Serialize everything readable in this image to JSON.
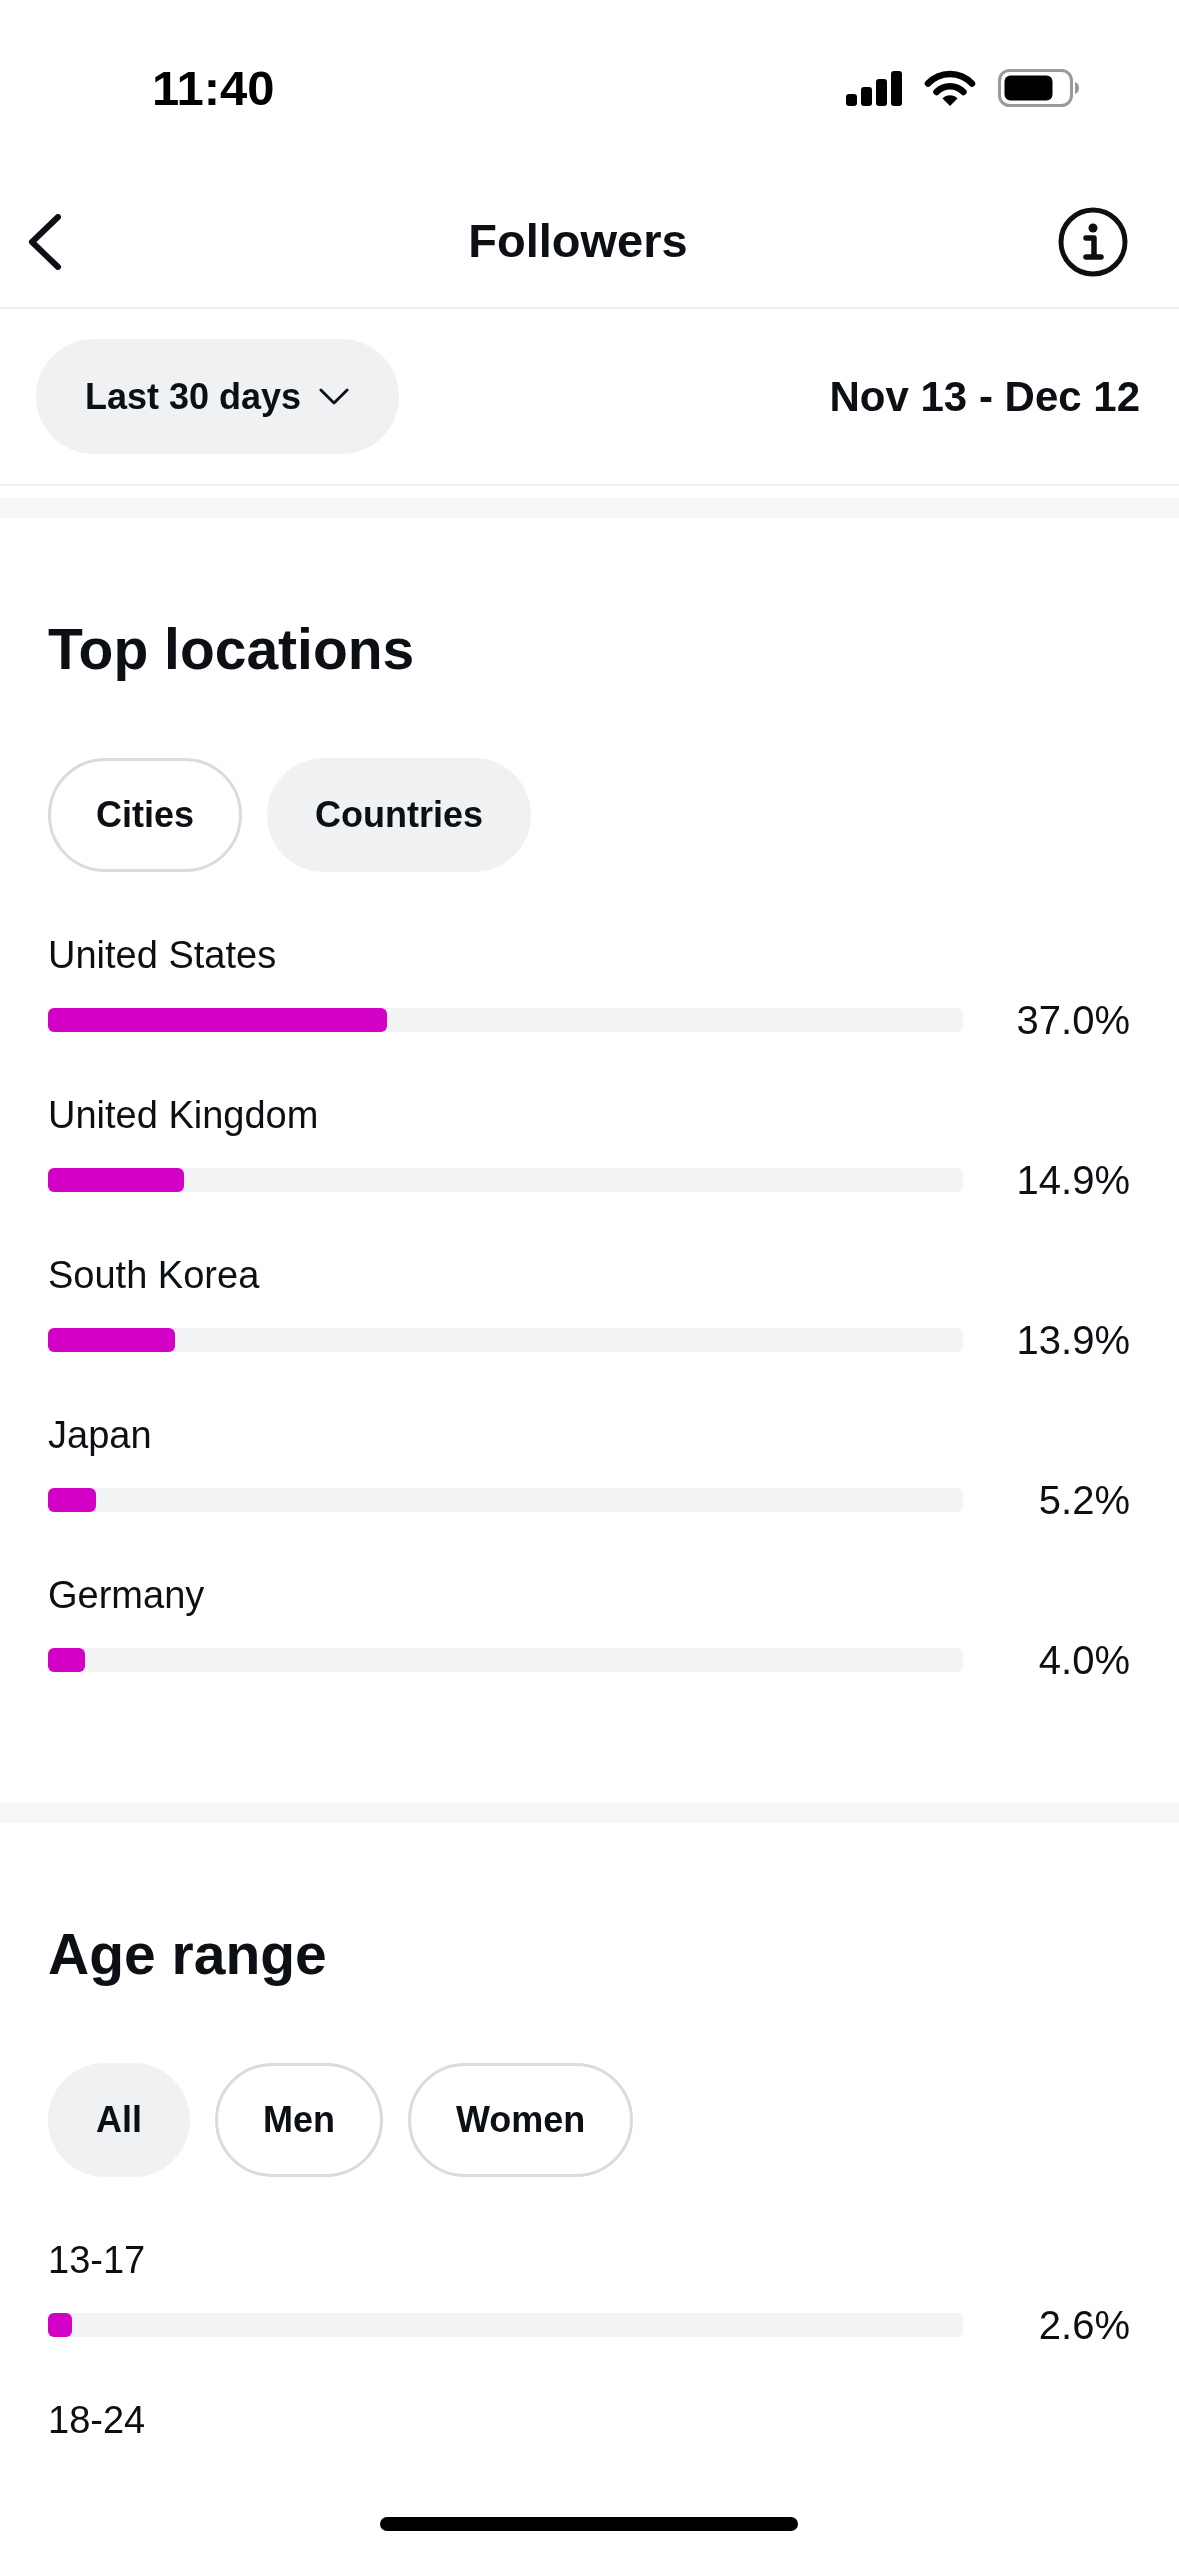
{
  "status_bar": {
    "time": "11:40"
  },
  "nav_bar": {
    "title": "Followers"
  },
  "filter": {
    "period": "Last 30 days",
    "date_range": "Nov 13 - Dec 12"
  },
  "sections": [
    {
      "title": "Top locations",
      "tabs": [
        {
          "label": "Cities",
          "selected": false
        },
        {
          "label": "Countries",
          "selected": true
        }
      ],
      "rows": [
        {
          "label": "United States",
          "level": 0.37,
          "value": "37.0%"
        },
        {
          "label": "United Kingdom",
          "level": 0.149,
          "value": "14.9%"
        },
        {
          "label": "South Korea",
          "level": 0.139,
          "value": "13.9%"
        },
        {
          "label": "Japan",
          "level": 0.052,
          "value": "5.2%"
        },
        {
          "label": "Germany",
          "level": 0.04,
          "value": "4.0%"
        }
      ]
    },
    {
      "title": "Age range",
      "tabs": [
        {
          "label": "All",
          "selected": true
        },
        {
          "label": "Men",
          "selected": false
        },
        {
          "label": "Women",
          "selected": false
        }
      ],
      "rows": [
        {
          "label": "13-17",
          "level": 0.026,
          "value": "2.6%"
        },
        {
          "label": "18-24"
        }
      ]
    }
  ]
}
